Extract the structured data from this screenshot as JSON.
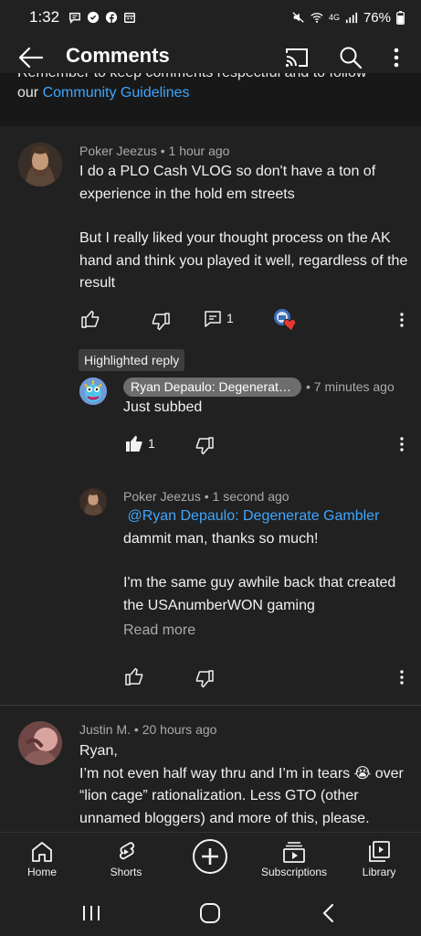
{
  "status_bar": {
    "time": "1:32",
    "network": "4G",
    "battery": "76%"
  },
  "app_bar": {
    "title": "Comments"
  },
  "guidelines": {
    "line1": "Remember to keep comments respectful and to follow",
    "prefix": "our ",
    "link": "Community Guidelines"
  },
  "comments": [
    {
      "author": "Poker Jeezus",
      "time": "1 hour ago",
      "paragraph1": "I do a PLO Cash VLOG so don't have a ton of experience in the hold em streets",
      "paragraph2": "But I really liked your thought process on the AK hand and think you played it well, regardless of the result",
      "reply_count": "1"
    },
    {
      "author": "Justin M.",
      "time": "20 hours ago",
      "line1": "Ryan,",
      "line2": "I’m not even half way thru and I’m in tears 😭 over “lion cage” rationalization. Less GTO (other unnamed bloggers) and more of this, please."
    }
  ],
  "replies": {
    "highlight_label": "Highlighted reply",
    "highlighted": {
      "author": "Ryan Depaulo: Degenerate …",
      "time": "7 minutes ago",
      "text": "Just subbed",
      "like_count": "1"
    },
    "second": {
      "author": "Poker Jeezus",
      "time": "1 second ago",
      "mention": "@Ryan Depaulo: Degenerate Gambler",
      "line1": "dammit man, thanks so much!",
      "line2": "I'm the same guy awhile back that created the USAnumberWON gaming",
      "read_more": "Read more"
    }
  },
  "bottom_nav": {
    "home": "Home",
    "shorts": "Shorts",
    "subscriptions": "Subscriptions",
    "library": "Library"
  },
  "colors": {
    "background": "#212121",
    "link": "#3ea6ff",
    "secondary_text": "#aaaaaa",
    "heart": "#e53935"
  }
}
